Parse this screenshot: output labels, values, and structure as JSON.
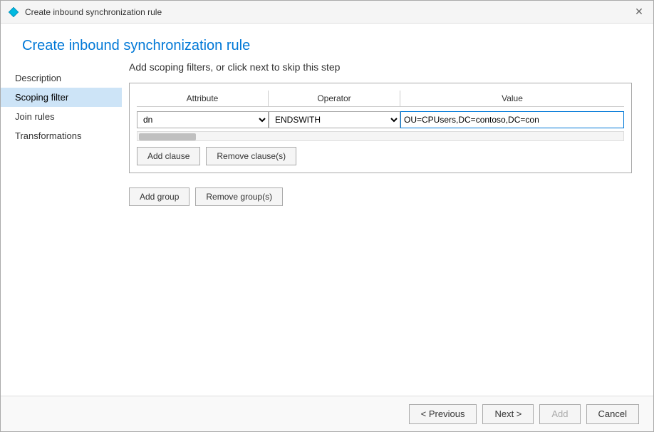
{
  "window": {
    "title": "Create inbound synchronization rule"
  },
  "page_title": "Create inbound synchronization rule",
  "section_subtitle": "Add scoping filters, or click next to skip this step",
  "sidebar": {
    "items": [
      {
        "id": "description",
        "label": "Description",
        "active": false
      },
      {
        "id": "scoping-filter",
        "label": "Scoping filter",
        "active": true
      },
      {
        "id": "join-rules",
        "label": "Join rules",
        "active": false
      },
      {
        "id": "transformations",
        "label": "Transformations",
        "active": false
      }
    ]
  },
  "filter_table": {
    "columns": [
      "Attribute",
      "Operator",
      "Value"
    ],
    "row": {
      "attribute": "dn",
      "operator": "ENDSWITH",
      "value": "OU=CPUsers,DC=contoso,DC=con"
    }
  },
  "buttons": {
    "add_clause": "Add clause",
    "remove_clause": "Remove clause(s)",
    "add_group": "Add group",
    "remove_group": "Remove group(s)"
  },
  "footer": {
    "previous": "< Previous",
    "next": "Next >",
    "add": "Add",
    "cancel": "Cancel"
  }
}
